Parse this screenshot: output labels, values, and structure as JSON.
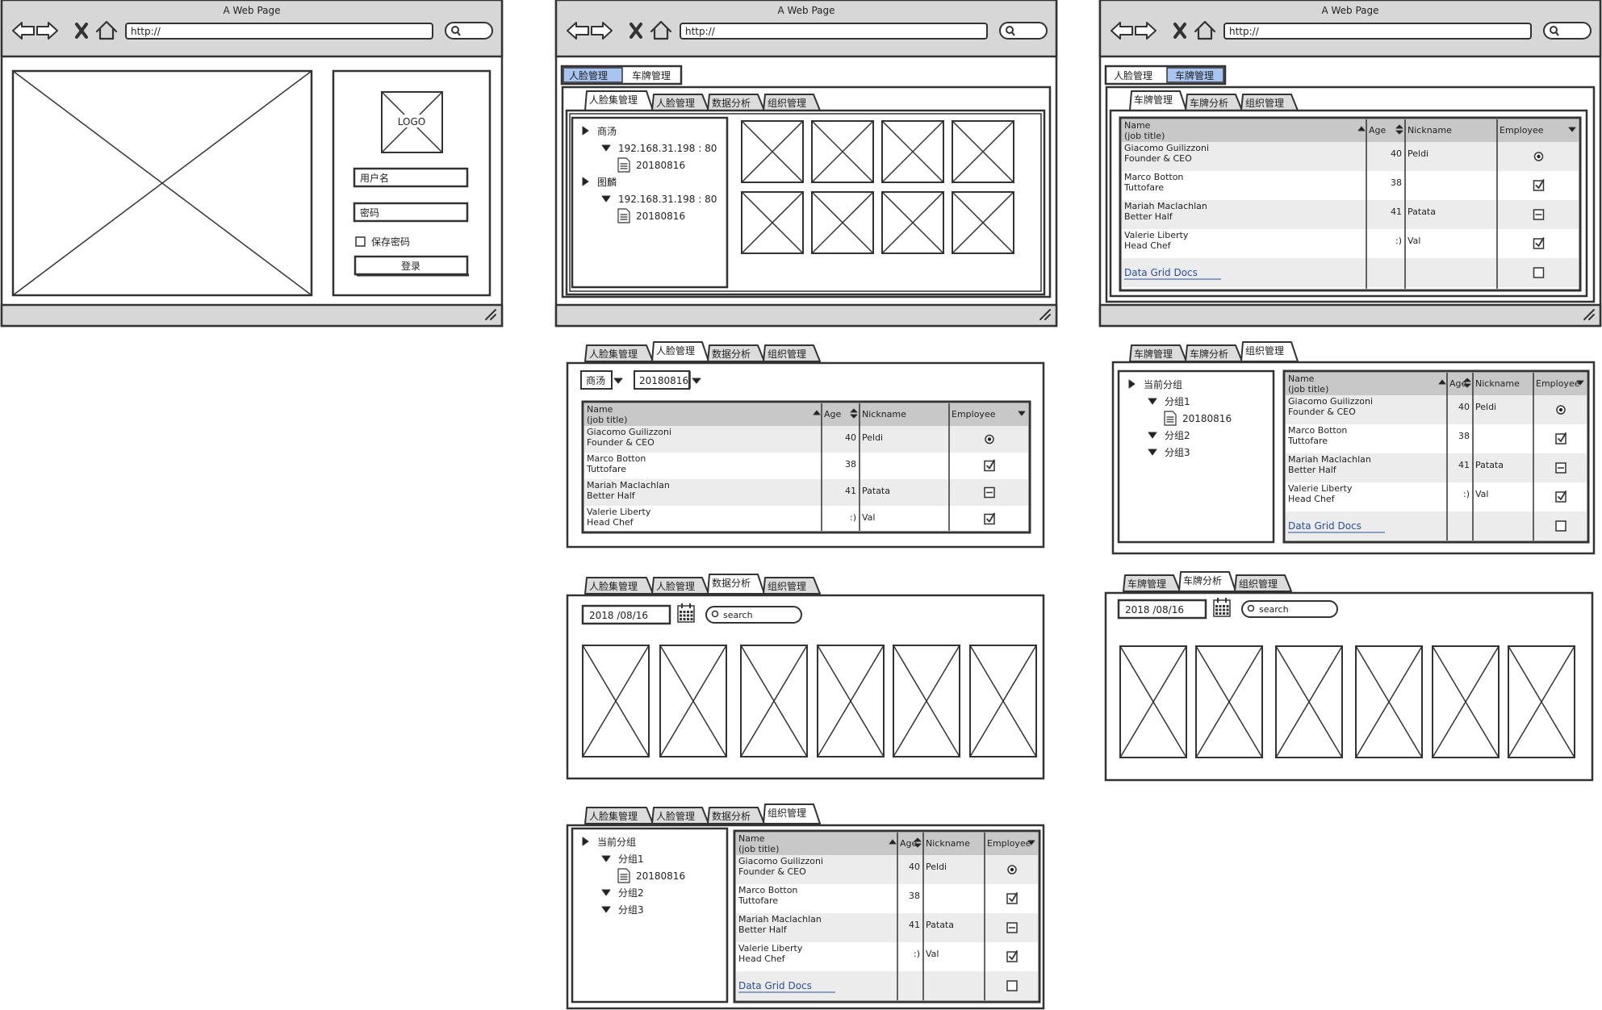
{
  "browser": {
    "title": "A Web Page",
    "url": "http://"
  },
  "login": {
    "logo": "LOGO",
    "username_placeholder": "用户名",
    "password_placeholder": "密码",
    "remember": "保存密码",
    "login_button": "登录"
  },
  "top_tabs": [
    "人脸管理",
    "车牌管理"
  ],
  "face_tabs": [
    "人脸集管理",
    "人脸管理",
    "数据分析",
    "组织管理"
  ],
  "plate_tabs": [
    "车牌管理",
    "车牌分析",
    "组织管理"
  ],
  "face_tree": [
    {
      "label": "商汤",
      "ip": "192.168.31.198 : 80",
      "date": "20180816"
    },
    {
      "label": "图麟",
      "ip": "192.168.31.198 : 80",
      "date": "20180816"
    }
  ],
  "group_tree": {
    "root": "当前分组",
    "groups": [
      "分组1",
      "分组2",
      "分组3"
    ],
    "file": "20180816"
  },
  "filters": {
    "site": "商汤",
    "date_file": "20180816",
    "date": "2018 /08/16",
    "search_placeholder": "search"
  },
  "grid": {
    "headers": {
      "name": "Name",
      "name_sub": "(job title)",
      "age": "Age",
      "nickname": "Nickname",
      "employee": "Employee"
    },
    "rows": [
      {
        "name": "Giacomo Guilizzoni",
        "title": "Founder & CEO",
        "age": "40",
        "nickname": "Peldi",
        "employee": "radio"
      },
      {
        "name": "Marco Botton",
        "title": "Tuttofare",
        "age": "38",
        "nickname": "",
        "employee": "checked"
      },
      {
        "name": "Mariah Maclachlan",
        "title": "Better Half",
        "age": "41",
        "nickname": "Patata",
        "employee": "mixed"
      },
      {
        "name": "Valerie Liberty",
        "title": "Head Chef",
        "age": ":)",
        "nickname": "Val",
        "employee": "checked"
      }
    ],
    "link": "Data Grid Docs"
  }
}
